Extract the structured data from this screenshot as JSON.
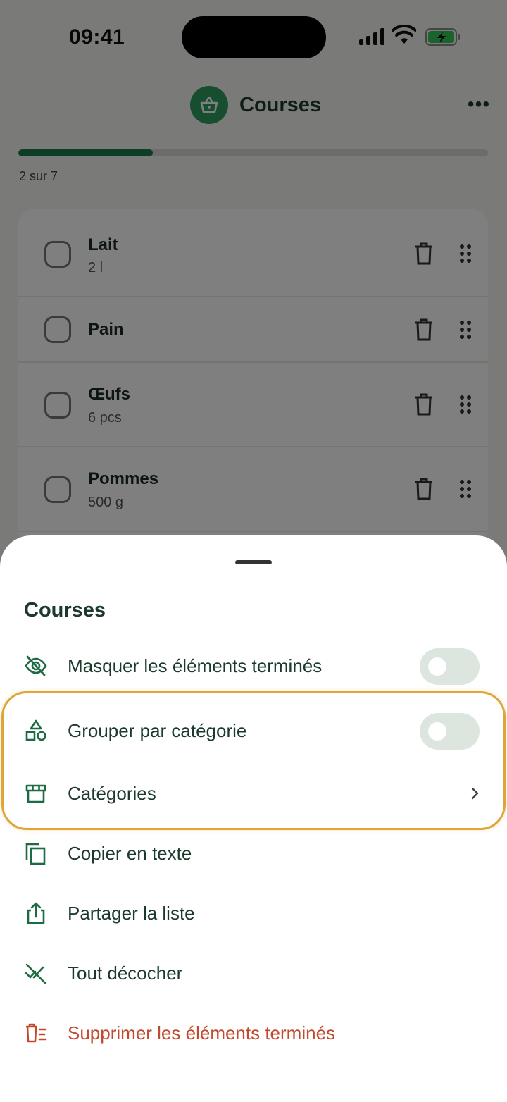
{
  "status_bar": {
    "time": "09:41"
  },
  "header": {
    "title": "Courses"
  },
  "progress": {
    "text": "2 sur 7",
    "fraction": 0.2857
  },
  "list": {
    "items": [
      {
        "name": "Lait",
        "qty": "2 l"
      },
      {
        "name": "Pain",
        "qty": ""
      },
      {
        "name": "Œufs",
        "qty": "6 pcs"
      },
      {
        "name": "Pommes",
        "qty": "500 g"
      }
    ]
  },
  "sheet": {
    "title": "Courses",
    "rows": {
      "hide_done": {
        "label": "Masquer les éléments terminés",
        "toggle_on": false,
        "icon": "eye-off-icon"
      },
      "group_category": {
        "label": "Grouper par catégorie",
        "toggle_on": false,
        "icon": "shapes-icon"
      },
      "categories": {
        "label": "Catégories",
        "icon": "storefront-icon"
      },
      "copy_text": {
        "label": "Copier en texte",
        "icon": "copy-icon"
      },
      "share_list": {
        "label": "Partager la liste",
        "icon": "share-icon"
      },
      "uncheck_all": {
        "label": "Tout décocher",
        "icon": "uncheck-all-icon"
      },
      "delete_done": {
        "label": "Supprimer les éléments terminés",
        "icon": "delete-list-icon"
      }
    }
  },
  "colors": {
    "accent": "#1a7d4b",
    "logo": "#2e9d5f",
    "danger": "#c24a2f",
    "highlight": "#e0a539"
  }
}
